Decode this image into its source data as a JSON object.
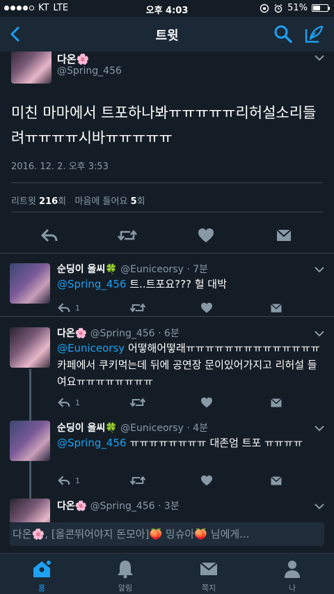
{
  "statusbar": {
    "carrier": "KT",
    "network": "LTE",
    "time": "오후 4:03",
    "battery": "51%",
    "battery_level": 0.51
  },
  "nav": {
    "title": "트윗"
  },
  "main_tweet": {
    "name": "다온🌸",
    "handle": "@Spring_456",
    "text": "미친 마마에서 트포하나봐ㅠㅠㅠㅠㅠ리허설소리들려ㅠㅠㅠㅠ시바ㅠㅠㅠㅠㅠ",
    "date": "2016. 12. 2. 오후 3:53",
    "retweet_label": "리트윗",
    "retweet_count": "216",
    "retweet_unit": "회",
    "like_label": "마음에 들어요",
    "like_count": "5",
    "like_unit": "회"
  },
  "replies": [
    {
      "name": "순딩이 올씨🍀",
      "meta": "@Euniceorsy · 7분",
      "mention": "@Spring_456",
      "text": " 트..트포요??? 헐 대박",
      "reply_count": "1"
    },
    {
      "name": "다온🌸",
      "meta": "@Spring_456 · 6분",
      "mention": "@Euniceorsy",
      "text": " 어떻해어떻래ㅠㅠㅠㅠㅠㅠㅠㅠㅠㅠㅠㅠㅠㅠ카페에서 쿠키먹는데 뒤에 공연장 문이있어가지고 리허설 들여요ㅠㅠㅠㅠㅠㅠㅠㅠ",
      "reply_count": "1"
    },
    {
      "name": "순딩이 올씨🍀",
      "meta": "@Euniceorsy · 4분",
      "mention": "@Spring_456",
      "text": " ㅠㅠㅠㅠㅠㅠㅠㅠ 대존엄 트포 ㅠㅠㅠㅠ",
      "reply_count": "1"
    },
    {
      "name": "다온🌸",
      "meta": "@Spring_456 · 3분"
    }
  ],
  "reply_input": {
    "placeholder": "다온🌸, [올콘뛰어야지 돈모아]🍑 밍슈아🍑 님에게..."
  },
  "tabs": [
    {
      "label": "홈"
    },
    {
      "label": "알림"
    },
    {
      "label": "쪽지"
    },
    {
      "label": "나"
    }
  ],
  "colors": {
    "background": "#141d26",
    "navbar": "#1b2836",
    "accent": "#1da1f2",
    "secondary_text": "#8899a6",
    "divider": "#38444d"
  }
}
